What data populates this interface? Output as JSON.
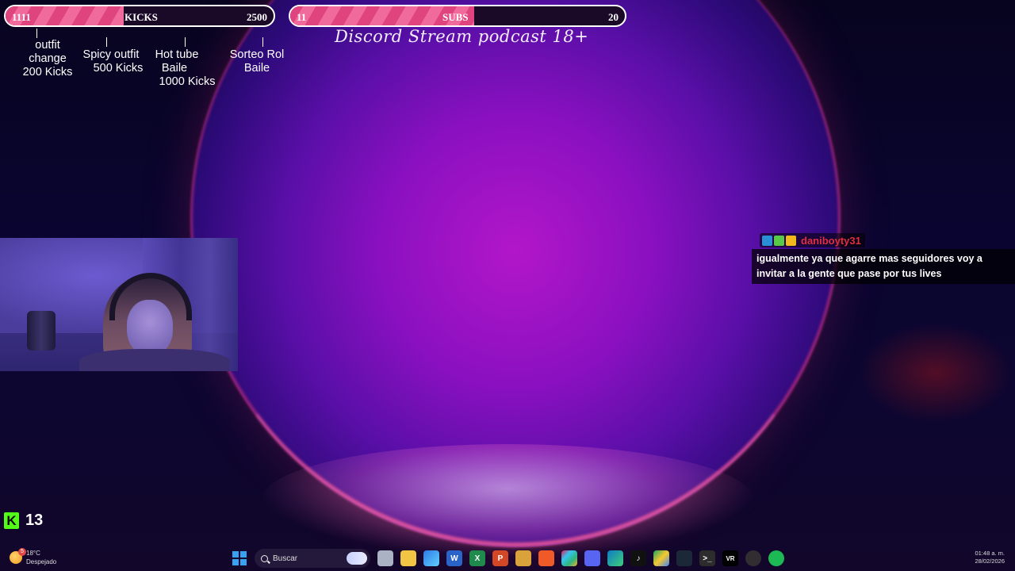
{
  "overlay": {
    "kicks_goal": {
      "current": "1111",
      "label": "KICKS",
      "target": "2500",
      "progress": 0.44
    },
    "subs_goal": {
      "current": "11",
      "label": "SUBS",
      "target": "20",
      "progress": 0.55
    },
    "stream_title": "Discord Stream podcast 18+",
    "milestones": [
      {
        "lines": [
          "outfit",
          "change",
          "200 Kicks"
        ]
      },
      {
        "lines": [
          "Spicy outfit",
          "500 Kicks"
        ]
      },
      {
        "lines": [
          "Hot tube",
          "Baile",
          "1000 Kicks"
        ]
      },
      {
        "lines": [
          "Sorteo Rol",
          "Baile"
        ]
      }
    ]
  },
  "chat": {
    "username": "daniboyty31",
    "message": "igualmente ya que agarre mas seguidores voy a invitar a la gente que pase por tus lives",
    "username_color": "#e02f3e"
  },
  "kick_counter": {
    "value": "13",
    "logo_letter": "K",
    "accent": "#53fc18"
  },
  "taskbar": {
    "weather": {
      "temp": "18°C",
      "condition": "Despejado",
      "alert_count": "5"
    },
    "search_placeholder": "Buscar",
    "apps": [
      "start",
      "search",
      "task-view",
      "file-explorer",
      "store",
      "word",
      "excel",
      "powerpoint",
      "folder",
      "brave",
      "slack",
      "discord",
      "edge",
      "tiktok",
      "drive",
      "steam",
      "terminal",
      "vrchat",
      "obs",
      "spotify"
    ],
    "clock": {
      "time": "01:48 a. m.",
      "date": "28/02/2026"
    }
  },
  "colors": {
    "goal_fill": "#e0447f",
    "accent_pink": "#f06a9c"
  }
}
